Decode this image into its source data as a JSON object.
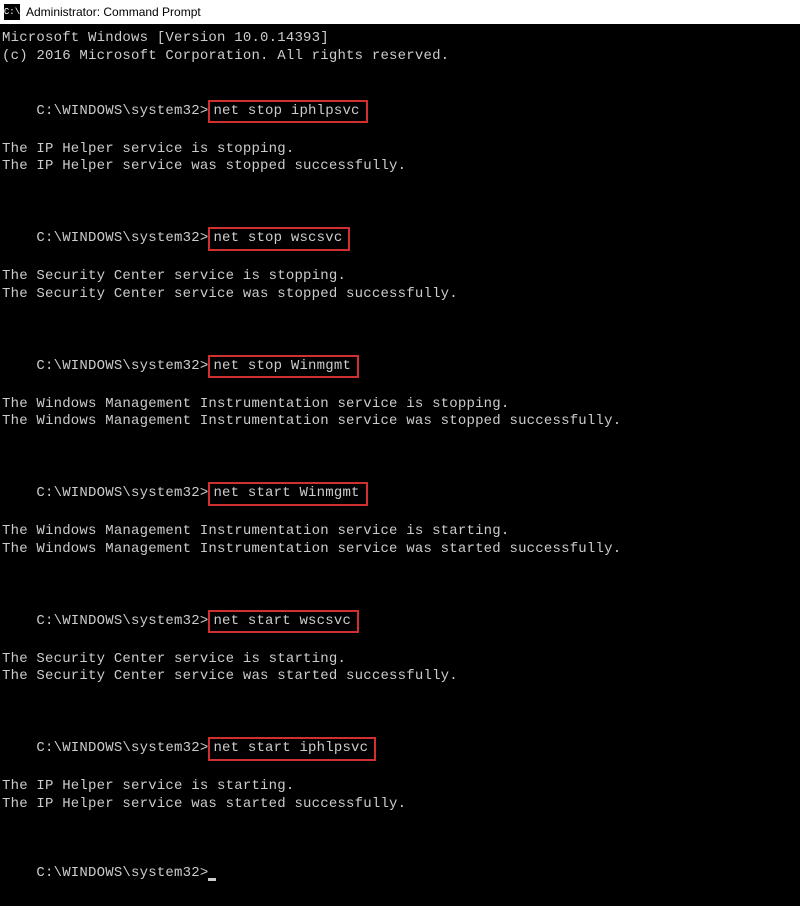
{
  "titlebar": {
    "icon_text": "C:\\",
    "title": "Administrator: Command Prompt"
  },
  "header": {
    "version_line": "Microsoft Windows [Version 10.0.14393]",
    "copyright_line": "(c) 2016 Microsoft Corporation. All rights reserved."
  },
  "blocks": [
    {
      "prompt": "C:\\WINDOWS\\system32>",
      "command": "net stop iphlpsvc",
      "out1": "The IP Helper service is stopping.",
      "out2": "The IP Helper service was stopped successfully."
    },
    {
      "prompt": "C:\\WINDOWS\\system32>",
      "command": "net stop wscsvc",
      "out1": "The Security Center service is stopping.",
      "out2": "The Security Center service was stopped successfully."
    },
    {
      "prompt": "C:\\WINDOWS\\system32>",
      "command": "net stop Winmgmt",
      "out1": "The Windows Management Instrumentation service is stopping.",
      "out2": "The Windows Management Instrumentation service was stopped successfully."
    },
    {
      "prompt": "C:\\WINDOWS\\system32>",
      "command": "net start Winmgmt",
      "out1": "The Windows Management Instrumentation service is starting.",
      "out2": "The Windows Management Instrumentation service was started successfully."
    },
    {
      "prompt": "C:\\WINDOWS\\system32>",
      "command": "net start wscsvc",
      "out1": "The Security Center service is starting.",
      "out2": "The Security Center service was started successfully."
    },
    {
      "prompt": "C:\\WINDOWS\\system32>",
      "command": "net start iphlpsvc",
      "out1": "The IP Helper service is starting.",
      "out2": "The IP Helper service was started successfully."
    }
  ],
  "final_prompt": "C:\\WINDOWS\\system32>"
}
